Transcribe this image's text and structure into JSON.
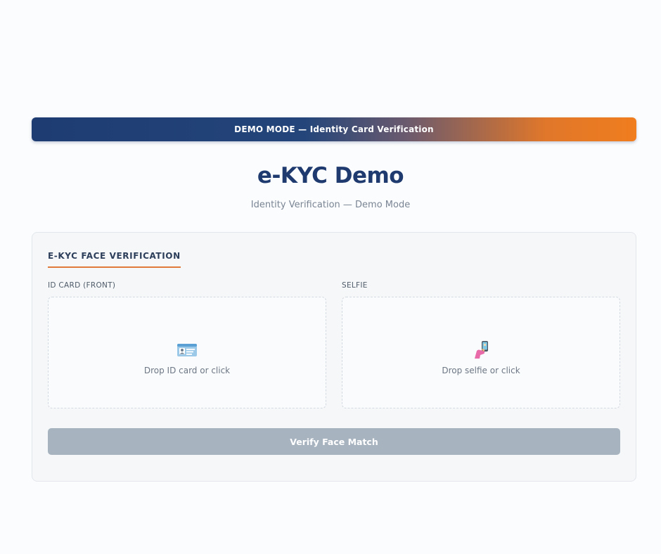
{
  "banner": {
    "text": "DEMO MODE — Identity Card Verification"
  },
  "header": {
    "title": "e-KYC Demo",
    "subtitle": "Identity Verification — Demo Mode"
  },
  "panel": {
    "title": "E-KYC FACE VERIFICATION",
    "id_card": {
      "label": "ID CARD (FRONT)",
      "icon": "id-card-icon",
      "prompt": "Drop ID card or click"
    },
    "selfie": {
      "label": "SELFIE",
      "icon": "selfie-icon",
      "prompt": "Drop selfie or click"
    },
    "verify_button": {
      "label": "Verify Face Match",
      "state": "disabled"
    }
  },
  "colors": {
    "primary_navy": "#1e3a6e",
    "accent_orange": "#f07d1e",
    "tab_underline": "#e07a3a",
    "disabled_button": "#a7b3bf"
  }
}
